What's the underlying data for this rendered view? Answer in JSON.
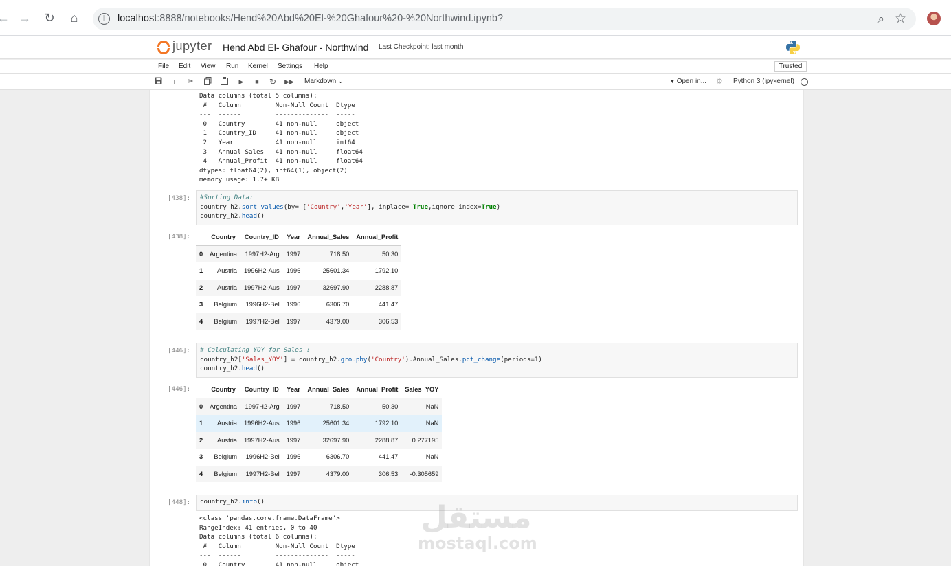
{
  "browser": {
    "url_host": "localhost",
    "url_rest": ":8888/notebooks/Hend%20Abd%20El-%20Ghafour%20-%20Northwind.ipynb?"
  },
  "header": {
    "wordmark": "jupyter",
    "notebook_title": "Hend Abd El- Ghafour - Northwind",
    "checkpoint": "Last Checkpoint: last month",
    "trusted": "Trusted"
  },
  "menu": [
    "File",
    "Edit",
    "View",
    "Run",
    "Kernel",
    "Settings",
    "Help"
  ],
  "toolbar": {
    "cell_type": "Markdown",
    "open_in": "Open in...",
    "kernel": "Python 3 (ipykernel)"
  },
  "cells": {
    "info_output_top": "Data columns (total 5 columns):\n #   Column         Non-Null Count  Dtype  \n---  ------         --------------  -----  \n 0   Country        41 non-null     object \n 1   Country_ID     41 non-null     object \n 2   Year           41 non-null     int64  \n 3   Annual_Sales   41 non-null     float64\n 4   Annual_Profit  41 non-null     float64\ndtypes: float64(2), int64(1), object(2)\nmemory usage: 1.7+ KB",
    "c438": {
      "in_prompt": "[438]:",
      "comment": "#Sorting Data:",
      "l2_a": "country_h2.",
      "l2_b": "sort_values",
      "l2_c": "(by= [",
      "l2_d": "'Country'",
      "l2_e": ",",
      "l2_f": "'Year'",
      "l2_g": "], inplace= ",
      "l2_h": "True",
      "l2_i": ",ignore_index=",
      "l2_j": "True",
      "l2_k": ")",
      "l3_a": "country_h2.",
      "l3_b": "head",
      "l3_c": "()",
      "out_prompt": "[438]:"
    },
    "c446": {
      "in_prompt": "[446]:",
      "comment": "# Calculating YOY for Sales :",
      "l2_a": "country_h2[",
      "l2_b": "'Sales_YOY'",
      "l2_c": "] = country_h2.",
      "l2_d": "groupby",
      "l2_e": "(",
      "l2_f": "'Country'",
      "l2_g": ").Annual_Sales.",
      "l2_h": "pct_change",
      "l2_i": "(periods=1)",
      "l3_a": "country_h2.",
      "l3_b": "head",
      "l3_c": "()",
      "out_prompt": "[446]:"
    },
    "c448": {
      "in_prompt": "[448]:",
      "l1_a": "country_h2.",
      "l1_b": "info",
      "l1_c": "()",
      "output": "<class 'pandas.core.frame.DataFrame'>\nRangeIndex: 41 entries, 0 to 40\nData columns (total 6 columns):\n #   Column         Non-Null Count  Dtype  \n---  ------         --------------  -----  \n 0   Country        41 non-null     object "
    }
  },
  "table1": {
    "columns": [
      "",
      "Country",
      "Country_ID",
      "Year",
      "Annual_Sales",
      "Annual_Profit"
    ],
    "rows": [
      [
        "0",
        "Argentina",
        "1997H2-Arg",
        "1997",
        "718.50",
        "50.30"
      ],
      [
        "1",
        "Austria",
        "1996H2-Aus",
        "1996",
        "25601.34",
        "1792.10"
      ],
      [
        "2",
        "Austria",
        "1997H2-Aus",
        "1997",
        "32697.90",
        "2288.87"
      ],
      [
        "3",
        "Belgium",
        "1996H2-Bel",
        "1996",
        "6306.70",
        "441.47"
      ],
      [
        "4",
        "Belgium",
        "1997H2-Bel",
        "1997",
        "4379.00",
        "306.53"
      ]
    ]
  },
  "table2": {
    "columns": [
      "",
      "Country",
      "Country_ID",
      "Year",
      "Annual_Sales",
      "Annual_Profit",
      "Sales_YOY"
    ],
    "rows": [
      [
        "0",
        "Argentina",
        "1997H2-Arg",
        "1997",
        "718.50",
        "50.30",
        "NaN"
      ],
      [
        "1",
        "Austria",
        "1996H2-Aus",
        "1996",
        "25601.34",
        "1792.10",
        "NaN"
      ],
      [
        "2",
        "Austria",
        "1997H2-Aus",
        "1997",
        "32697.90",
        "2288.87",
        "0.277195"
      ],
      [
        "3",
        "Belgium",
        "1996H2-Bel",
        "1996",
        "6306.70",
        "441.47",
        "NaN"
      ],
      [
        "4",
        "Belgium",
        "1997H2-Bel",
        "1997",
        "4379.00",
        "306.53",
        "-0.305659"
      ]
    ]
  },
  "watermark": {
    "arabic": "مستقل",
    "latin": "mostaql.com"
  },
  "colors": {
    "jupyter_orange": "#f37726",
    "row_hover": "#e2f1fb",
    "code_bg": "#f7f7f7"
  }
}
